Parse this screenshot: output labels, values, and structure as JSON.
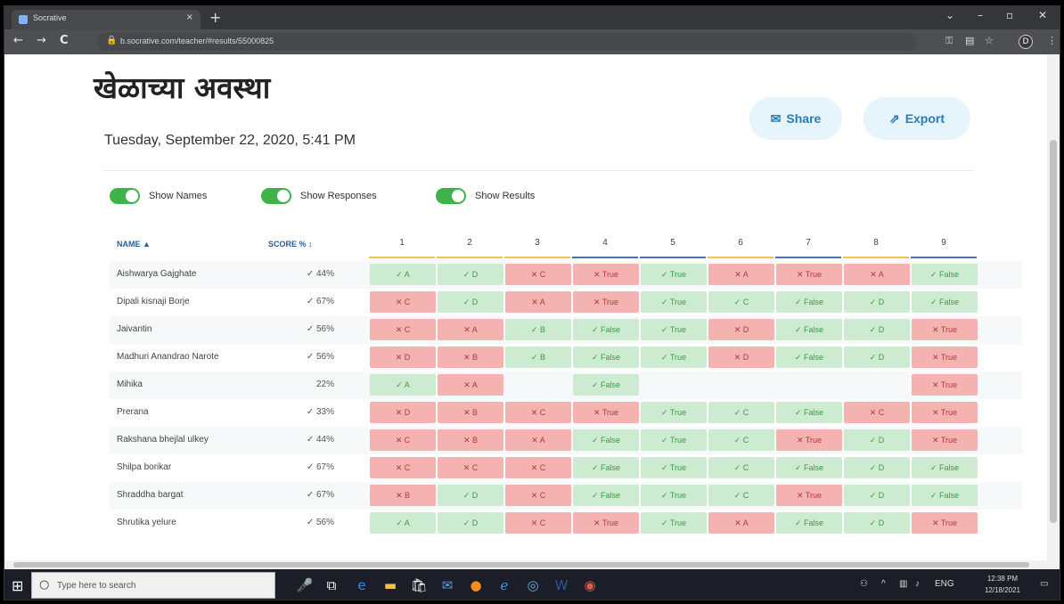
{
  "browser": {
    "tab_title": "Socrative",
    "tab_close": "×",
    "new_tab": "+",
    "url": "b.socrative.com/teacher/#results/55000825",
    "controls": {
      "minimize": "–",
      "maximize": "▫",
      "close": "✕",
      "chevron": "⌄"
    },
    "nav": {
      "back": "←",
      "forward": "→",
      "reload": "C"
    },
    "profile_initial": "D"
  },
  "page": {
    "title": "खेळाच्या अवस्था",
    "date": "Tuesday, September 22, 2020, 5:41 PM",
    "share_label": "Share",
    "export_label": "Export",
    "toggles": {
      "names": "Show Names",
      "responses": "Show Responses",
      "results": "Show Results"
    }
  },
  "table": {
    "name_header": "NAME ▲",
    "score_header": "SCORE % ↕",
    "questions": [
      "1",
      "2",
      "3",
      "4",
      "5",
      "6",
      "7",
      "8",
      "9"
    ],
    "question_colors": [
      "#f2c14e",
      "#f2c14e",
      "#f2c14e",
      "#4a6fb8",
      "#4a6fb8",
      "#f2c14e",
      "#4a6fb8",
      "#f2c14e",
      "#4a6fb8"
    ],
    "rows": [
      {
        "name": "Aishwarya Gajghate",
        "score": "✓ 44%",
        "cells": [
          [
            "ok",
            "✓ A"
          ],
          [
            "ok",
            "✓ D"
          ],
          [
            "bad",
            "✕ C"
          ],
          [
            "bad",
            "✕ True"
          ],
          [
            "ok",
            "✓ True"
          ],
          [
            "bad",
            "✕ A"
          ],
          [
            "bad",
            "✕ True"
          ],
          [
            "bad",
            "✕ A"
          ],
          [
            "ok",
            "✓ False"
          ]
        ]
      },
      {
        "name": "Dipali kisnaji Borje",
        "score": "✓ 67%",
        "cells": [
          [
            "bad",
            "✕ C"
          ],
          [
            "ok",
            "✓ D"
          ],
          [
            "bad",
            "✕ A"
          ],
          [
            "bad",
            "✕ True"
          ],
          [
            "ok",
            "✓ True"
          ],
          [
            "ok",
            "✓ C"
          ],
          [
            "ok",
            "✓ False"
          ],
          [
            "ok",
            "✓ D"
          ],
          [
            "ok",
            "✓ False"
          ]
        ]
      },
      {
        "name": "Jaivantin",
        "score": "✓ 56%",
        "cells": [
          [
            "bad",
            "✕ C"
          ],
          [
            "bad",
            "✕ A"
          ],
          [
            "ok",
            "✓ B"
          ],
          [
            "ok",
            "✓ False"
          ],
          [
            "ok",
            "✓ True"
          ],
          [
            "bad",
            "✕ D"
          ],
          [
            "ok",
            "✓ False"
          ],
          [
            "ok",
            "✓ D"
          ],
          [
            "bad",
            "✕ True"
          ]
        ]
      },
      {
        "name": "Madhuri Anandrao Narote",
        "score": "✓ 56%",
        "cells": [
          [
            "bad",
            "✕ D"
          ],
          [
            "bad",
            "✕ B"
          ],
          [
            "ok",
            "✓ B"
          ],
          [
            "ok",
            "✓ False"
          ],
          [
            "ok",
            "✓ True"
          ],
          [
            "bad",
            "✕ D"
          ],
          [
            "ok",
            "✓ False"
          ],
          [
            "ok",
            "✓ D"
          ],
          [
            "bad",
            "✕ True"
          ]
        ]
      },
      {
        "name": "Mihika",
        "score": "22%",
        "cells": [
          [
            "ok",
            "✓ A"
          ],
          [
            "bad",
            "✕ A"
          ],
          [
            "empty",
            ""
          ],
          [
            "ok",
            "✓ False"
          ],
          [
            "empty",
            ""
          ],
          [
            "empty",
            ""
          ],
          [
            "empty",
            ""
          ],
          [
            "empty",
            ""
          ],
          [
            "bad",
            "✕ True"
          ]
        ]
      },
      {
        "name": "Prerana",
        "score": "✓ 33%",
        "cells": [
          [
            "bad",
            "✕ D"
          ],
          [
            "bad",
            "✕ B"
          ],
          [
            "bad",
            "✕ C"
          ],
          [
            "bad",
            "✕ True"
          ],
          [
            "ok",
            "✓ True"
          ],
          [
            "ok",
            "✓ C"
          ],
          [
            "ok",
            "✓ False"
          ],
          [
            "bad",
            "✕ C"
          ],
          [
            "bad",
            "✕ True"
          ]
        ]
      },
      {
        "name": "Rakshana bhejlal ulkey",
        "score": "✓ 44%",
        "cells": [
          [
            "bad",
            "✕ C"
          ],
          [
            "bad",
            "✕ B"
          ],
          [
            "bad",
            "✕ A"
          ],
          [
            "ok",
            "✓ False"
          ],
          [
            "ok",
            "✓ True"
          ],
          [
            "ok",
            "✓ C"
          ],
          [
            "bad",
            "✕ True"
          ],
          [
            "ok",
            "✓ D"
          ],
          [
            "bad",
            "✕ True"
          ]
        ]
      },
      {
        "name": "Shilpa borikar",
        "score": "✓ 67%",
        "cells": [
          [
            "bad",
            "✕ C"
          ],
          [
            "bad",
            "✕ C"
          ],
          [
            "bad",
            "✕ C"
          ],
          [
            "ok",
            "✓ False"
          ],
          [
            "ok",
            "✓ True"
          ],
          [
            "ok",
            "✓ C"
          ],
          [
            "ok",
            "✓ False"
          ],
          [
            "ok",
            "✓ D"
          ],
          [
            "ok",
            "✓ False"
          ]
        ]
      },
      {
        "name": "Shraddha bargat",
        "score": "✓ 67%",
        "cells": [
          [
            "bad",
            "✕ B"
          ],
          [
            "ok",
            "✓ D"
          ],
          [
            "bad",
            "✕ C"
          ],
          [
            "ok",
            "✓ False"
          ],
          [
            "ok",
            "✓ True"
          ],
          [
            "ok",
            "✓ C"
          ],
          [
            "bad",
            "✕ True"
          ],
          [
            "ok",
            "✓ D"
          ],
          [
            "ok",
            "✓ False"
          ]
        ]
      },
      {
        "name": "Shrutika yelure",
        "score": "✓ 56%",
        "cells": [
          [
            "ok",
            "✓ A"
          ],
          [
            "ok",
            "✓ D"
          ],
          [
            "bad",
            "✕ C"
          ],
          [
            "bad",
            "✕ True"
          ],
          [
            "ok",
            "✓ True"
          ],
          [
            "bad",
            "✕ A"
          ],
          [
            "ok",
            "✓ False"
          ],
          [
            "ok",
            "✓ D"
          ],
          [
            "bad",
            "✕ True"
          ]
        ]
      }
    ]
  },
  "taskbar": {
    "search_placeholder": "Type here to search",
    "time": "12:38 PM",
    "date": "12/18/2021",
    "lang": "ENG"
  }
}
